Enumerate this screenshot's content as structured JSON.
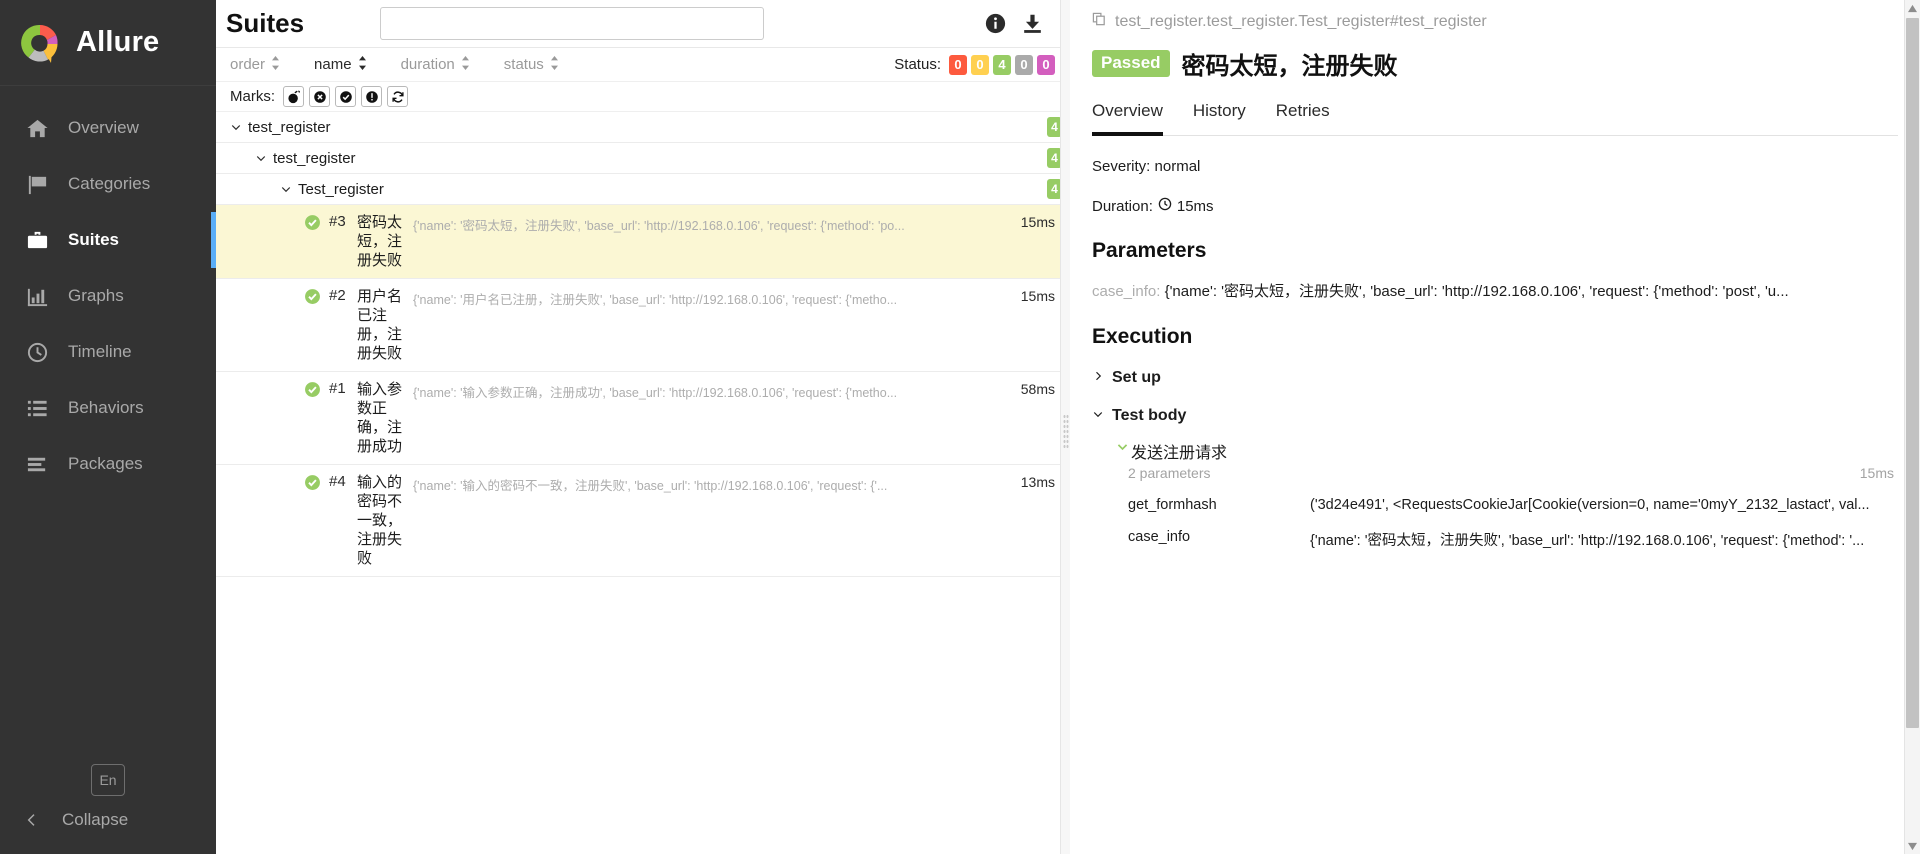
{
  "sidebar": {
    "brand": "Allure",
    "items": [
      {
        "label": "Overview",
        "icon": "home-icon",
        "active": false
      },
      {
        "label": "Categories",
        "icon": "flag-icon",
        "active": false
      },
      {
        "label": "Suites",
        "icon": "briefcase-icon",
        "active": true
      },
      {
        "label": "Graphs",
        "icon": "bar-chart-icon",
        "active": false
      },
      {
        "label": "Timeline",
        "icon": "clock-icon",
        "active": false
      },
      {
        "label": "Behaviors",
        "icon": "list-icon",
        "active": false
      },
      {
        "label": "Packages",
        "icon": "layers-icon",
        "active": false
      }
    ],
    "language": "En",
    "collapse": "Collapse"
  },
  "center": {
    "title": "Suites",
    "search_value": "",
    "search_placeholder": "",
    "info_icon": "info-icon",
    "export_icon": "download-icon",
    "sort": [
      {
        "label": "order",
        "active": false
      },
      {
        "label": "name",
        "active": true
      },
      {
        "label": "duration",
        "active": false
      },
      {
        "label": "status",
        "active": false
      }
    ],
    "status_label": "Status:",
    "status_badges": [
      {
        "value": "0",
        "color": "#fd5a3e",
        "name": "failed"
      },
      {
        "value": "0",
        "color": "#ffd050",
        "name": "broken"
      },
      {
        "value": "4",
        "color": "#97cc64",
        "name": "passed"
      },
      {
        "value": "0",
        "color": "#aaaaaa",
        "name": "skipped"
      },
      {
        "value": "0",
        "color": "#d35ebe",
        "name": "unknown"
      }
    ],
    "marks_label": "Marks:",
    "marks": [
      {
        "icon": "bomb-icon"
      },
      {
        "icon": "x-circle-icon"
      },
      {
        "icon": "check-circle-icon"
      },
      {
        "icon": "exclamation-circle-icon"
      },
      {
        "icon": "refresh-icon"
      }
    ],
    "tree": [
      {
        "label": "test_register",
        "count": "4",
        "level": 1
      },
      {
        "label": "test_register",
        "count": "4",
        "level": 2
      },
      {
        "label": "Test_register",
        "count": "4",
        "level": 3
      }
    ],
    "tests": [
      {
        "order": "#3",
        "name": "密码太短，注册失败",
        "description": "{'name': '密码太短，注册失败', 'base_url': 'http://192.168.0.106', 'request': {'method': 'po...",
        "duration": "15ms",
        "status": "passed",
        "selected": true
      },
      {
        "order": "#2",
        "name": "用户名已注册，注册失败",
        "description": "{'name': '用户名已注册，注册失败', 'base_url': 'http://192.168.0.106', 'request': {'metho...",
        "duration": "15ms",
        "status": "passed",
        "selected": false
      },
      {
        "order": "#1",
        "name": "输入参数正确，注册成功",
        "description": "{'name': '输入参数正确，注册成功', 'base_url': 'http://192.168.0.106', 'request': {'metho...",
        "duration": "58ms",
        "status": "passed",
        "selected": false
      },
      {
        "order": "#4",
        "name": "输入的密码不一致，注册失败",
        "description": "{'name': '输入的密码不一致，注册失败', 'base_url': 'http://192.168.0.106', 'request': {'...",
        "duration": "13ms",
        "status": "passed",
        "selected": false
      }
    ]
  },
  "detail": {
    "breadcrumb": "test_register.test_register.Test_register#test_register",
    "copy_icon": "copy-icon",
    "status_badge": "Passed",
    "title": "密码太短，注册失败",
    "tabs": [
      {
        "label": "Overview",
        "active": true
      },
      {
        "label": "History",
        "active": false
      },
      {
        "label": "Retries",
        "active": false
      }
    ],
    "severity": "Severity: normal",
    "duration_label": "Duration:",
    "duration_icon": "clock-icon",
    "duration_value": "15ms",
    "parameters_heading": "Parameters",
    "parameters": [
      {
        "key": "case_info:",
        "value": "{'name': '密码太短，注册失败', 'base_url': 'http://192.168.0.106', 'request': {'method': 'post', 'u..."
      }
    ],
    "execution_heading": "Execution",
    "nodes": [
      {
        "label": "Set up",
        "expanded": false
      },
      {
        "label": "Test body",
        "expanded": true
      }
    ],
    "step": {
      "title": "发送注册请求",
      "subtitle": "2 parameters",
      "duration": "15ms",
      "rows": [
        {
          "key": "get_formhash",
          "value": "('3d24e491', <RequestsCookieJar[Cookie(version=0, name='0myY_2132_lastact', val..."
        },
        {
          "key": "case_info",
          "value": "{'name': '密码太短，注册失败', 'base_url': 'http://192.168.0.106', 'request': {'method': '..."
        }
      ]
    }
  },
  "colors": {
    "sidebar_bg": "#333333",
    "active_indicator": "#5aaef7",
    "passed_green": "#97cc64",
    "selected_row": "#fbf7d4"
  }
}
